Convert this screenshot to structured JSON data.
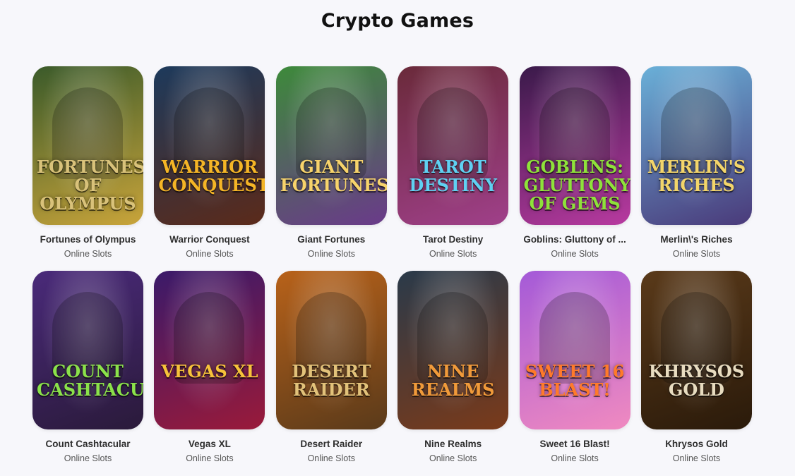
{
  "page": {
    "title": "Crypto Games"
  },
  "games": [
    {
      "name": "Fortunes of Olympus",
      "category": "Online Slots",
      "logo": "Fortunes of Olympus",
      "bg": "#3a5a2a",
      "bg2": "#c9a43a",
      "logo_color": "#d9c27a"
    },
    {
      "name": "Warrior Conquest",
      "category": "Online Slots",
      "logo": "Warrior Conquest",
      "bg": "#1d3a5c",
      "bg2": "#5b2a1a",
      "logo_color": "#f5b526"
    },
    {
      "name": "Giant Fortunes",
      "category": "Online Slots",
      "logo": "Giant Fortunes",
      "bg": "#3d8a3a",
      "bg2": "#6a3a8a",
      "logo_color": "#f7d36b"
    },
    {
      "name": "Tarot Destiny",
      "category": "Online Slots",
      "logo": "Tarot Destiny",
      "bg": "#6a2a3a",
      "bg2": "#a0408a",
      "logo_color": "#5fd1f2"
    },
    {
      "name": "Goblins: Gluttony of ...",
      "category": "Online Slots",
      "logo": "Goblins: Gluttony of Gems",
      "bg": "#3a1a4a",
      "bg2": "#b83aa0",
      "logo_color": "#8ee23a"
    },
    {
      "name": "Merlin\\'s Riches",
      "category": "Online Slots",
      "logo": "Merlin's Riches",
      "bg": "#6ab0d8",
      "bg2": "#4a3a7a",
      "logo_color": "#f3d56a"
    },
    {
      "name": "Count Cashtacular",
      "category": "Online Slots",
      "logo": "Count Cashtacular",
      "bg": "#4a2a7a",
      "bg2": "#2a1a3a",
      "logo_color": "#8be24a"
    },
    {
      "name": "Vegas XL",
      "category": "Online Slots",
      "logo": "Vegas XL",
      "bg": "#3a1a6a",
      "bg2": "#9a1a3a",
      "logo_color": "#f7c23a"
    },
    {
      "name": "Desert Raider",
      "category": "Online Slots",
      "logo": "Desert Raider",
      "bg": "#b8621a",
      "bg2": "#5a3a1a",
      "logo_color": "#e2c27a"
    },
    {
      "name": "Nine Realms",
      "category": "Online Slots",
      "logo": "Nine Realms",
      "bg": "#2a3a4a",
      "bg2": "#7a3a1a",
      "logo_color": "#f09a3a"
    },
    {
      "name": "Sweet 16 Blast!",
      "category": "Online Slots",
      "logo": "Sweet 16 Blast!",
      "bg": "#a45ad8",
      "bg2": "#f08ac0",
      "logo_color": "#ff7a2a"
    },
    {
      "name": "Khrysos Gold",
      "category": "Online Slots",
      "logo": "Khrysos Gold",
      "bg": "#5a3a1a",
      "bg2": "#2a1a0a",
      "logo_color": "#e8dcc0"
    }
  ]
}
